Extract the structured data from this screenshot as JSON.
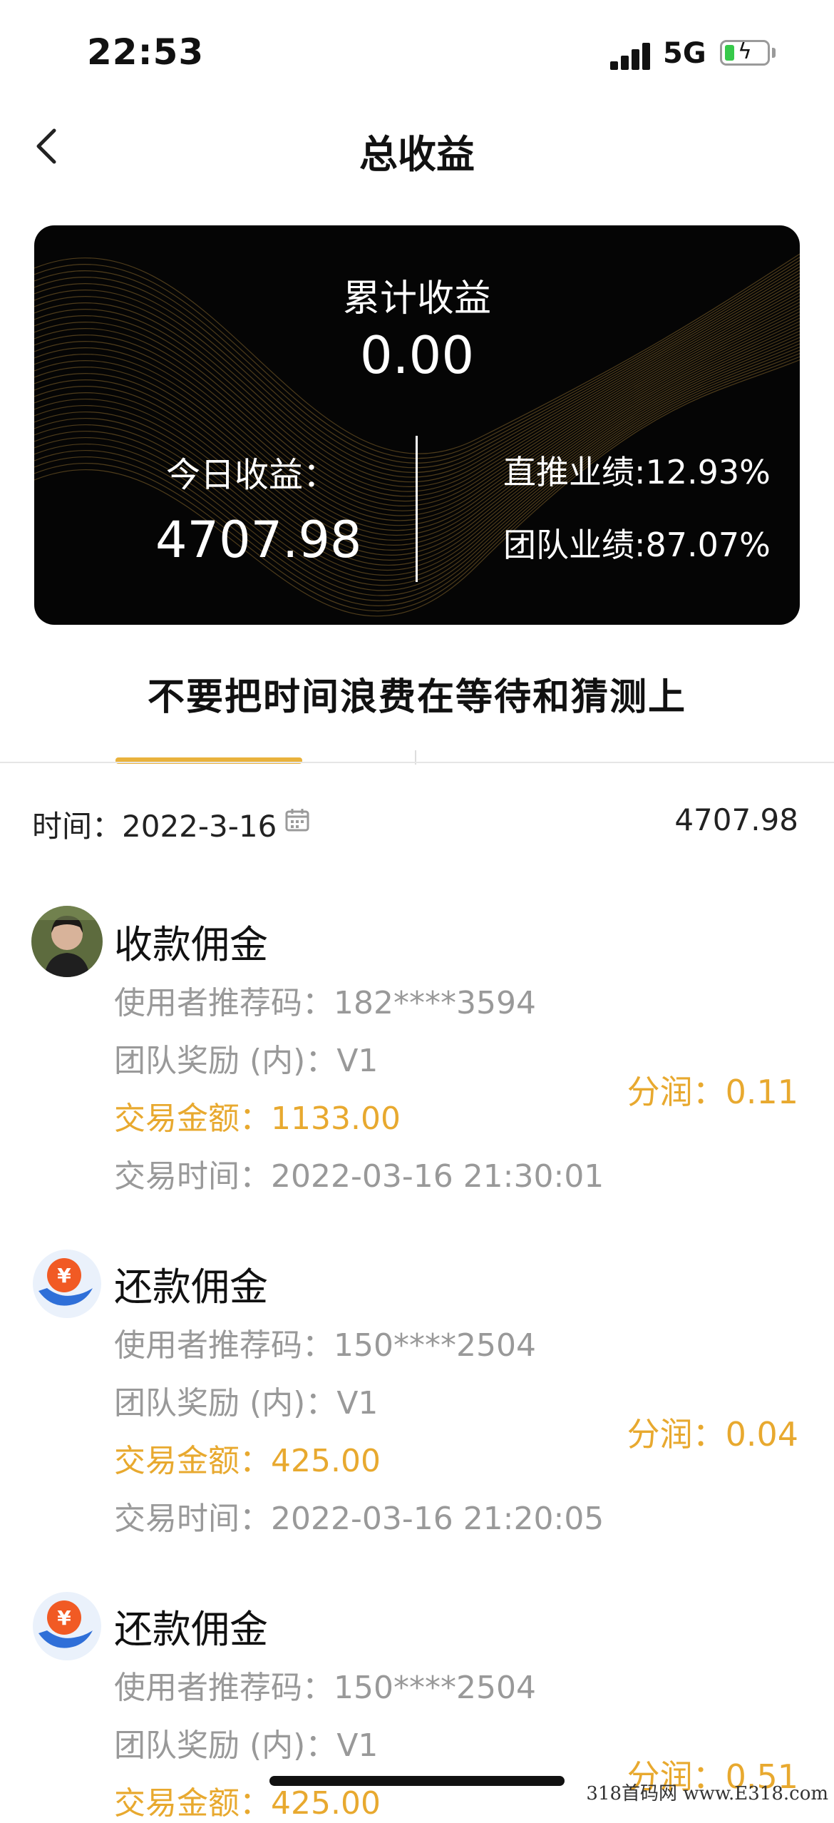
{
  "status_bar": {
    "time": "22:53",
    "network": "5G"
  },
  "header": {
    "title": "总收益"
  },
  "card": {
    "cumulative_label": "累计收益",
    "cumulative_value": "0.00",
    "today_label": "今日收益：",
    "today_value": "4707.98",
    "direct_perf": "直推业绩:12.93%",
    "team_perf": "团队业绩:87.07%"
  },
  "banner": "不要把时间浪费在等待和猜测上",
  "filter": {
    "date_label": "时间：2022-3-16",
    "total": "4707.98"
  },
  "records": [
    {
      "title": "收款佣金",
      "icon": "user-avatar",
      "referral": "使用者推荐码：182****3594",
      "team_reward": "团队奖励 (内)：V1",
      "amount": "交易金额：1133.00",
      "time": "交易时间：2022-03-16 21:30:01",
      "share": "分润：0.11"
    },
    {
      "title": "还款佣金",
      "icon": "yen-hand-icon",
      "referral": "使用者推荐码：150****2504",
      "team_reward": "团队奖励 (内)：V1",
      "amount": "交易金额：425.00",
      "time": "交易时间：2022-03-16 21:20:05",
      "share": "分润：0.04"
    },
    {
      "title": "还款佣金",
      "icon": "yen-hand-icon",
      "referral": "使用者推荐码：150****2504",
      "team_reward": "团队奖励 (内)：V1",
      "amount": "交易金额：425.00",
      "share": "分润：0.51"
    }
  ],
  "watermark": "318首码网 www.E318.com",
  "colors": {
    "gold": "#e8a92f",
    "tab_indicator": "#e9b23c",
    "card_bg": "#050505"
  }
}
